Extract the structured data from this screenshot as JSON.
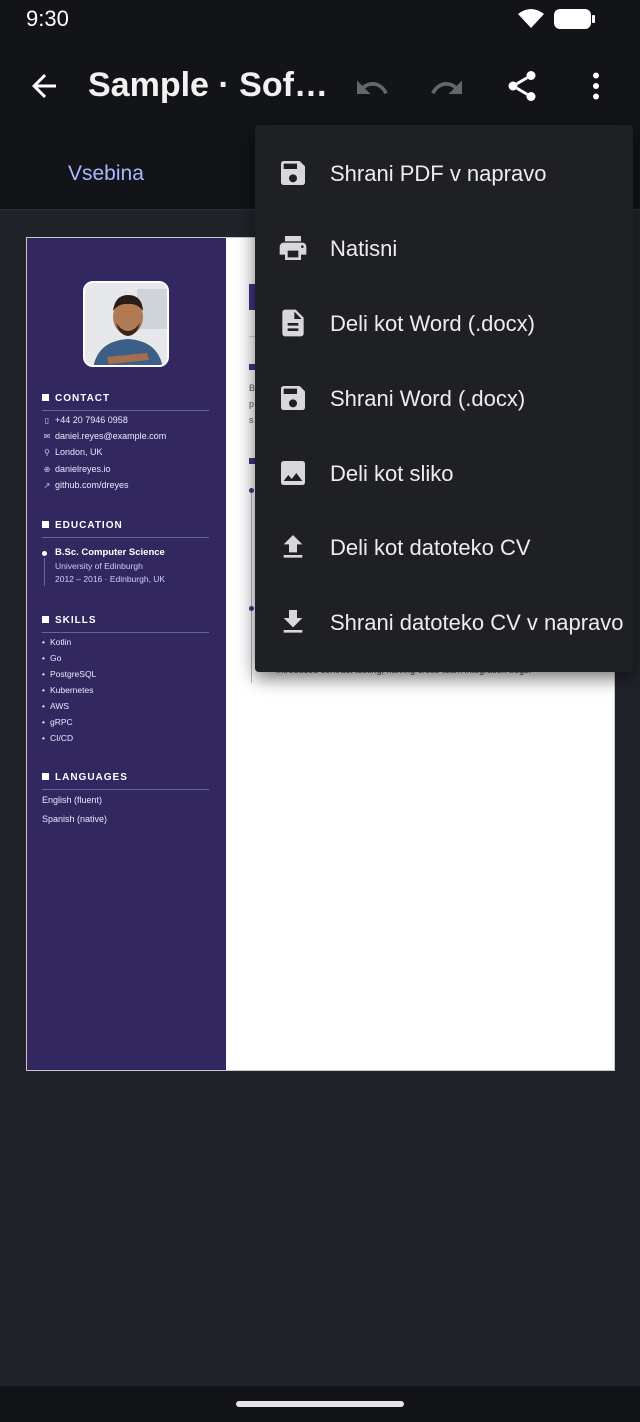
{
  "status_bar": {
    "time": "9:30"
  },
  "app_bar": {
    "title": "Sample · Soft…"
  },
  "tabs": {
    "content": "Vsebina"
  },
  "cv": {
    "sections": {
      "contact": "CONTACT",
      "education": "EDUCATION",
      "skills": "SKILLS",
      "languages": "LANGUAGES"
    },
    "contact": [
      {
        "icon": "phone-icon",
        "text": "+44 20 7946 0958"
      },
      {
        "icon": "mail-icon",
        "text": "daniel.reyes@example.com"
      },
      {
        "icon": "location-icon",
        "text": "London, UK"
      },
      {
        "icon": "globe-icon",
        "text": "danielreyes.io"
      },
      {
        "icon": "link-icon",
        "text": "github.com/dreyes"
      }
    ],
    "education": {
      "degree": "B.Sc. Computer Science",
      "school": "University of Edinburgh",
      "dates": "2012 – 2016 · Edinburgh, UK"
    },
    "skills": [
      "Kotlin",
      "Go",
      "PostgreSQL",
      "Kubernetes",
      "AWS",
      "gRPC",
      "CI/CD"
    ],
    "languages": [
      "English (fluent)",
      "Spanish (native)"
    ],
    "main": {
      "visible_chars": [
        "B",
        "p",
        "s"
      ],
      "cutoff_line": "introduced contract testing, halving cross-team integration bugs."
    }
  },
  "menu": {
    "items": [
      {
        "label": "Shrani PDF v napravo",
        "icon": "save-icon"
      },
      {
        "label": "Natisni",
        "icon": "print-icon"
      },
      {
        "label": "Deli kot Word (.docx)",
        "icon": "document-icon"
      },
      {
        "label": "Shrani Word (.docx)",
        "icon": "save-icon"
      },
      {
        "label": "Deli kot sliko",
        "icon": "image-icon"
      },
      {
        "label": "Deli kot datoteko CV",
        "icon": "upload-icon"
      },
      {
        "label": "Shrani datoteko CV v napravo",
        "icon": "download-icon"
      }
    ]
  },
  "colors": {
    "sidebar": "#32285f",
    "accent": "#3d3585",
    "tab_active": "#a9b8ff",
    "menu_bg": "#1f2024",
    "background": "#202329"
  }
}
